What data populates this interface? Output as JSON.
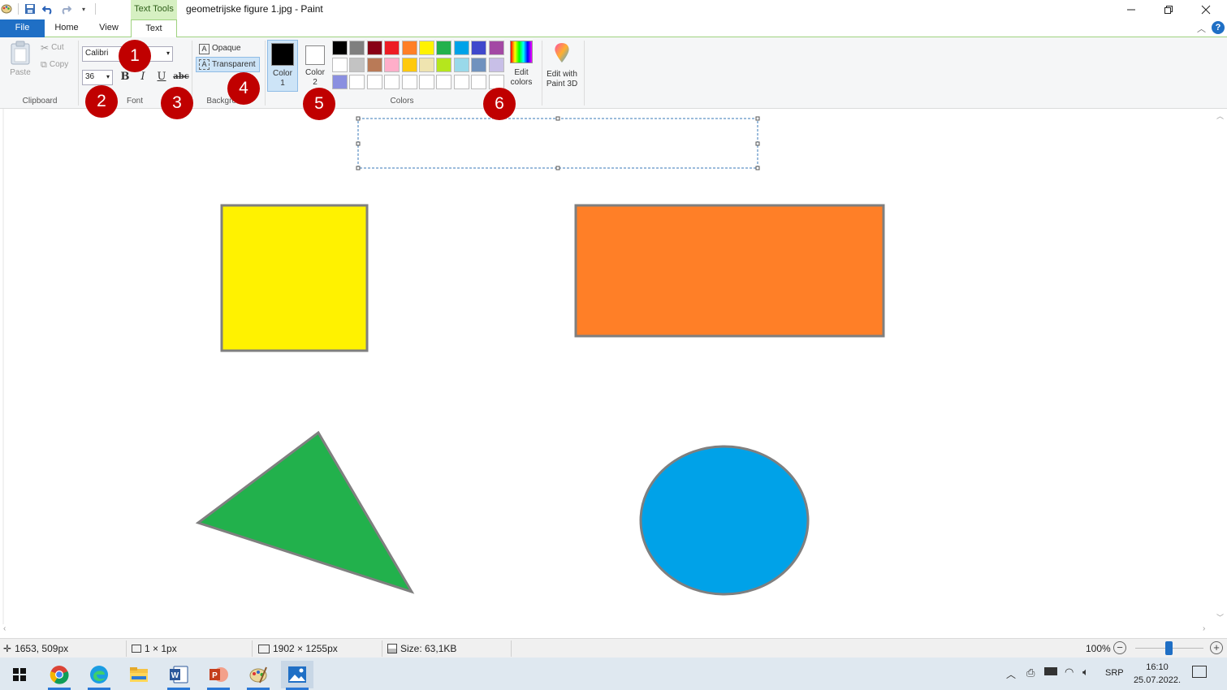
{
  "window": {
    "title": "geometrijske figure 1.jpg - Paint",
    "context_tab": "Text Tools"
  },
  "tabs": {
    "file": "File",
    "home": "Home",
    "view": "View",
    "text": "Text"
  },
  "clipboard": {
    "paste": "Paste",
    "cut": "Cut",
    "copy": "Copy",
    "group": "Clipboard"
  },
  "font": {
    "family": "Calibri",
    "size": "36",
    "bold": "B",
    "italic": "I",
    "underline": "U",
    "strike": "abc",
    "group": "Font"
  },
  "background": {
    "opaque": "Opaque",
    "transparent": "Transparent",
    "group": "Background"
  },
  "colors": {
    "color1": "Color 1",
    "color2": "Color 2",
    "edit": "Edit colors",
    "paint3d": "Edit with Paint 3D",
    "group": "Colors",
    "color1_value": "#000000",
    "color2_value": "#ffffff",
    "palette_row1": [
      "#000000",
      "#7f7f7f",
      "#880015",
      "#ed1c24",
      "#ff7f27",
      "#fff200",
      "#22b14c",
      "#00a2e8",
      "#3f48cc",
      "#a349a4"
    ],
    "palette_row2": [
      "#ffffff",
      "#c3c3c3",
      "#b97a57",
      "#ffaec9",
      "#ffc90e",
      "#efe4b0",
      "#b5e61d",
      "#99d9ea",
      "#7092be",
      "#c8bfe7"
    ],
    "palette_row3": [
      "#8a8fe0",
      "#ffffff",
      "#ffffff",
      "#ffffff",
      "#ffffff",
      "#ffffff",
      "#ffffff",
      "#ffffff",
      "#ffffff",
      "#ffffff"
    ]
  },
  "badges": [
    "1",
    "2",
    "3",
    "4",
    "5",
    "6"
  ],
  "shapes": {
    "square_color": "#fff200",
    "rectangle_color": "#ff7f27",
    "triangle_color": "#22b14c",
    "ellipse_color": "#00a2e8",
    "outline_color": "#7f7f7f"
  },
  "status": {
    "cursor": "1653, 509px",
    "selection": "1 × 1px",
    "image_size": "1902 × 1255px",
    "file_size": "Size: 63,1KB",
    "zoom": "100%"
  },
  "tray": {
    "lang": "SRP",
    "time": "16:10",
    "date": "25.07.2022."
  }
}
